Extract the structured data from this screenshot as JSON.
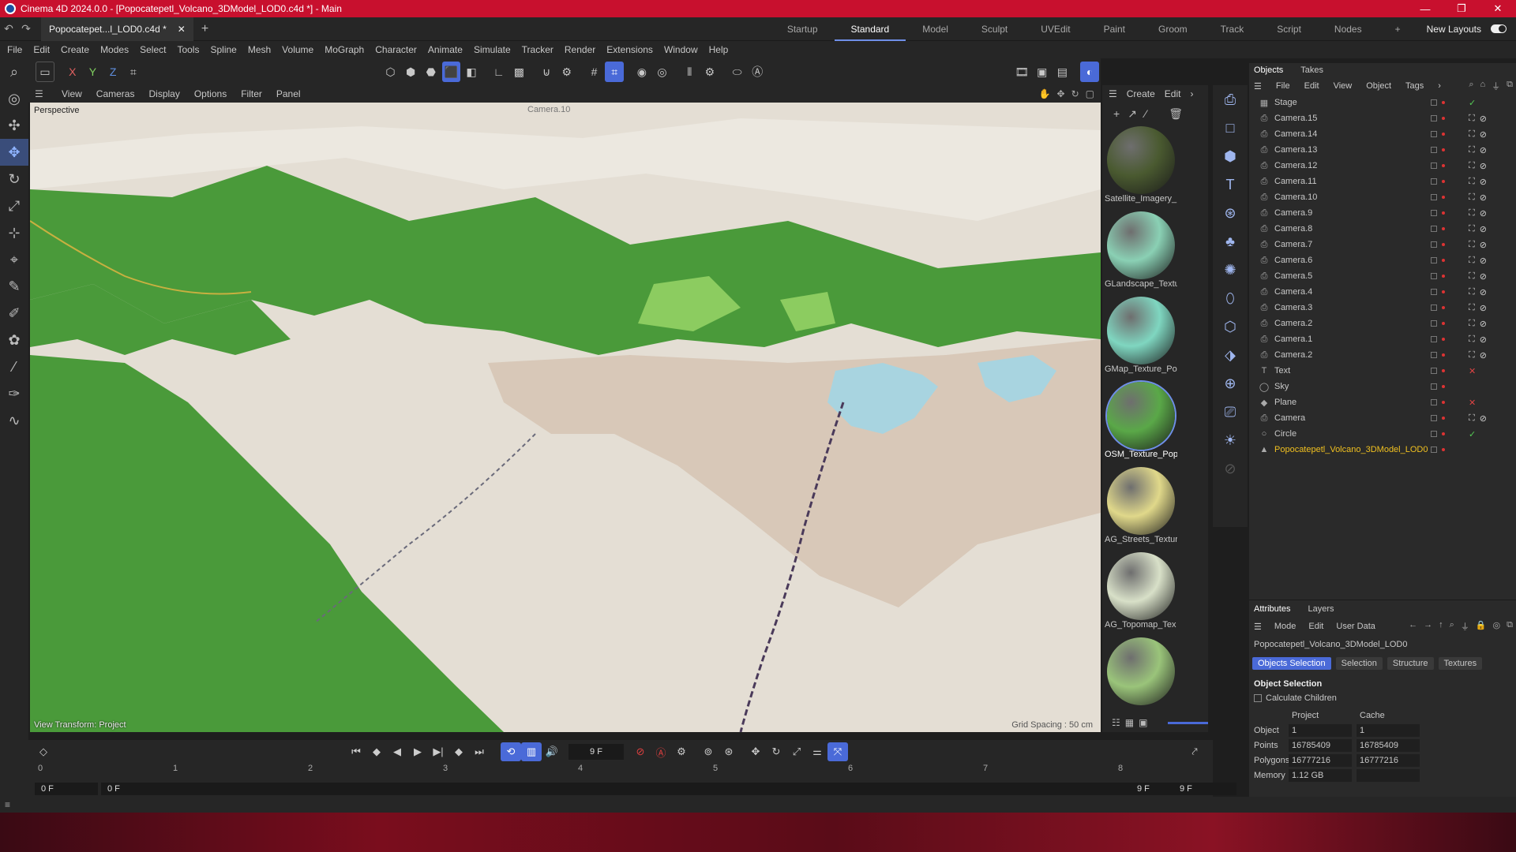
{
  "titlebar": {
    "title": "Cinema 4D 2024.0.0 - [Popocatepetl_Volcano_3DModel_LOD0.c4d *] - Main",
    "min": "—",
    "max": "❐",
    "close": "✕"
  },
  "doc_tab": {
    "label": "Popocatepet...l_LOD0.c4d *",
    "close": "✕"
  },
  "layouts": {
    "items": [
      "Startup",
      "Standard",
      "Model",
      "Sculpt",
      "UVEdit",
      "Paint",
      "Groom",
      "Track",
      "Script",
      "Nodes"
    ],
    "active": "Standard",
    "new_layouts": "New Layouts",
    "plus": "+"
  },
  "menubar": [
    "File",
    "Edit",
    "Create",
    "Modes",
    "Select",
    "Tools",
    "Spline",
    "Mesh",
    "Volume",
    "MoGraph",
    "Character",
    "Animate",
    "Simulate",
    "Tracker",
    "Render",
    "Extensions",
    "Window",
    "Help"
  ],
  "axis_buttons": {
    "x": "X",
    "y": "Y",
    "z": "Z"
  },
  "viewport": {
    "menu": [
      "View",
      "Cameras",
      "Display",
      "Options",
      "Filter",
      "Panel"
    ],
    "label": "Perspective",
    "camera": "Camera.10",
    "transform": "View Transform: Project",
    "grid": "Grid Spacing : 50 cm",
    "colors": {
      "forest": "#4a9a3a",
      "terrain": "#e4ded4",
      "lake": "#a8d4e0"
    }
  },
  "materials": {
    "menu": [
      "Create",
      "Edit"
    ],
    "items": [
      {
        "name": "Satellite_Imagery_",
        "color": "#4a5a30"
      },
      {
        "name": "GLandscape_Textu",
        "color": "#8ad0b4"
      },
      {
        "name": "GMap_Texture_Po",
        "color": "#7fd6c0"
      },
      {
        "name": "OSM_Texture_Pop",
        "color": "#5aa848"
      },
      {
        "name": "AG_Streets_Textur",
        "color": "#e0d88a"
      },
      {
        "name": "AG_Topomap_Tex",
        "color": "#d8e0c8"
      },
      {
        "name": "",
        "color": "#9ac47a"
      }
    ],
    "selected": "OSM_Texture_Pop"
  },
  "objects": {
    "tabs": [
      "Objects",
      "Takes"
    ],
    "menu": [
      "File",
      "Edit",
      "View",
      "Object",
      "Tags"
    ],
    "items": [
      {
        "name": "Stage",
        "icon": "stage-icon"
      },
      {
        "name": "Camera.15",
        "icon": "camera-icon"
      },
      {
        "name": "Camera.14",
        "icon": "camera-icon"
      },
      {
        "name": "Camera.13",
        "icon": "camera-icon"
      },
      {
        "name": "Camera.12",
        "icon": "camera-icon"
      },
      {
        "name": "Camera.11",
        "icon": "camera-icon"
      },
      {
        "name": "Camera.10",
        "icon": "camera-icon"
      },
      {
        "name": "Camera.9",
        "icon": "camera-icon"
      },
      {
        "name": "Camera.8",
        "icon": "camera-icon"
      },
      {
        "name": "Camera.7",
        "icon": "camera-icon"
      },
      {
        "name": "Camera.6",
        "icon": "camera-icon"
      },
      {
        "name": "Camera.5",
        "icon": "camera-icon"
      },
      {
        "name": "Camera.4",
        "icon": "camera-icon"
      },
      {
        "name": "Camera.3",
        "icon": "camera-icon"
      },
      {
        "name": "Camera.2",
        "icon": "camera-icon"
      },
      {
        "name": "Camera.1",
        "icon": "camera-icon"
      },
      {
        "name": "Camera.2",
        "icon": "camera-icon"
      },
      {
        "name": "Text",
        "icon": "text-icon"
      },
      {
        "name": "Sky",
        "icon": "sky-icon"
      },
      {
        "name": "Plane",
        "icon": "plane-icon"
      },
      {
        "name": "Camera",
        "icon": "camera-icon"
      },
      {
        "name": "Circle",
        "icon": "circle-icon"
      },
      {
        "name": "Popocatepetl_Volcano_3DModel_LOD0",
        "icon": "polygon-icon"
      }
    ],
    "selected": "Popocatepetl_Volcano_3DModel_LOD0"
  },
  "attributes": {
    "tabs": [
      "Attributes",
      "Layers"
    ],
    "menu": [
      "Mode",
      "Edit",
      "User Data"
    ],
    "object_name": "Popocatepetl_Volcano_3DModel_LOD0",
    "subtabs": [
      "Objects Selection",
      "Selection",
      "Structure",
      "Textures"
    ],
    "active_subtab": "Objects Selection",
    "section": "Object Selection",
    "calc_children": "Calculate Children",
    "col_project": "Project",
    "col_cache": "Cache",
    "rows": [
      {
        "key": "Object",
        "project": "1",
        "cache": "1"
      },
      {
        "key": "Points",
        "project": "16785409",
        "cache": "16785409"
      },
      {
        "key": "Polygons",
        "project": "16777216",
        "cache": "16777216"
      },
      {
        "key": "Memory",
        "project": "1.12 GB",
        "cache": ""
      }
    ]
  },
  "timeline": {
    "current_frame": "9 F",
    "ticks": [
      "0",
      "1",
      "2",
      "3",
      "4",
      "5",
      "6",
      "7",
      "8"
    ],
    "start": "0 F",
    "range_start": "0 F",
    "range_end": "9 F",
    "end": "9 F"
  },
  "statusbar": "≡"
}
